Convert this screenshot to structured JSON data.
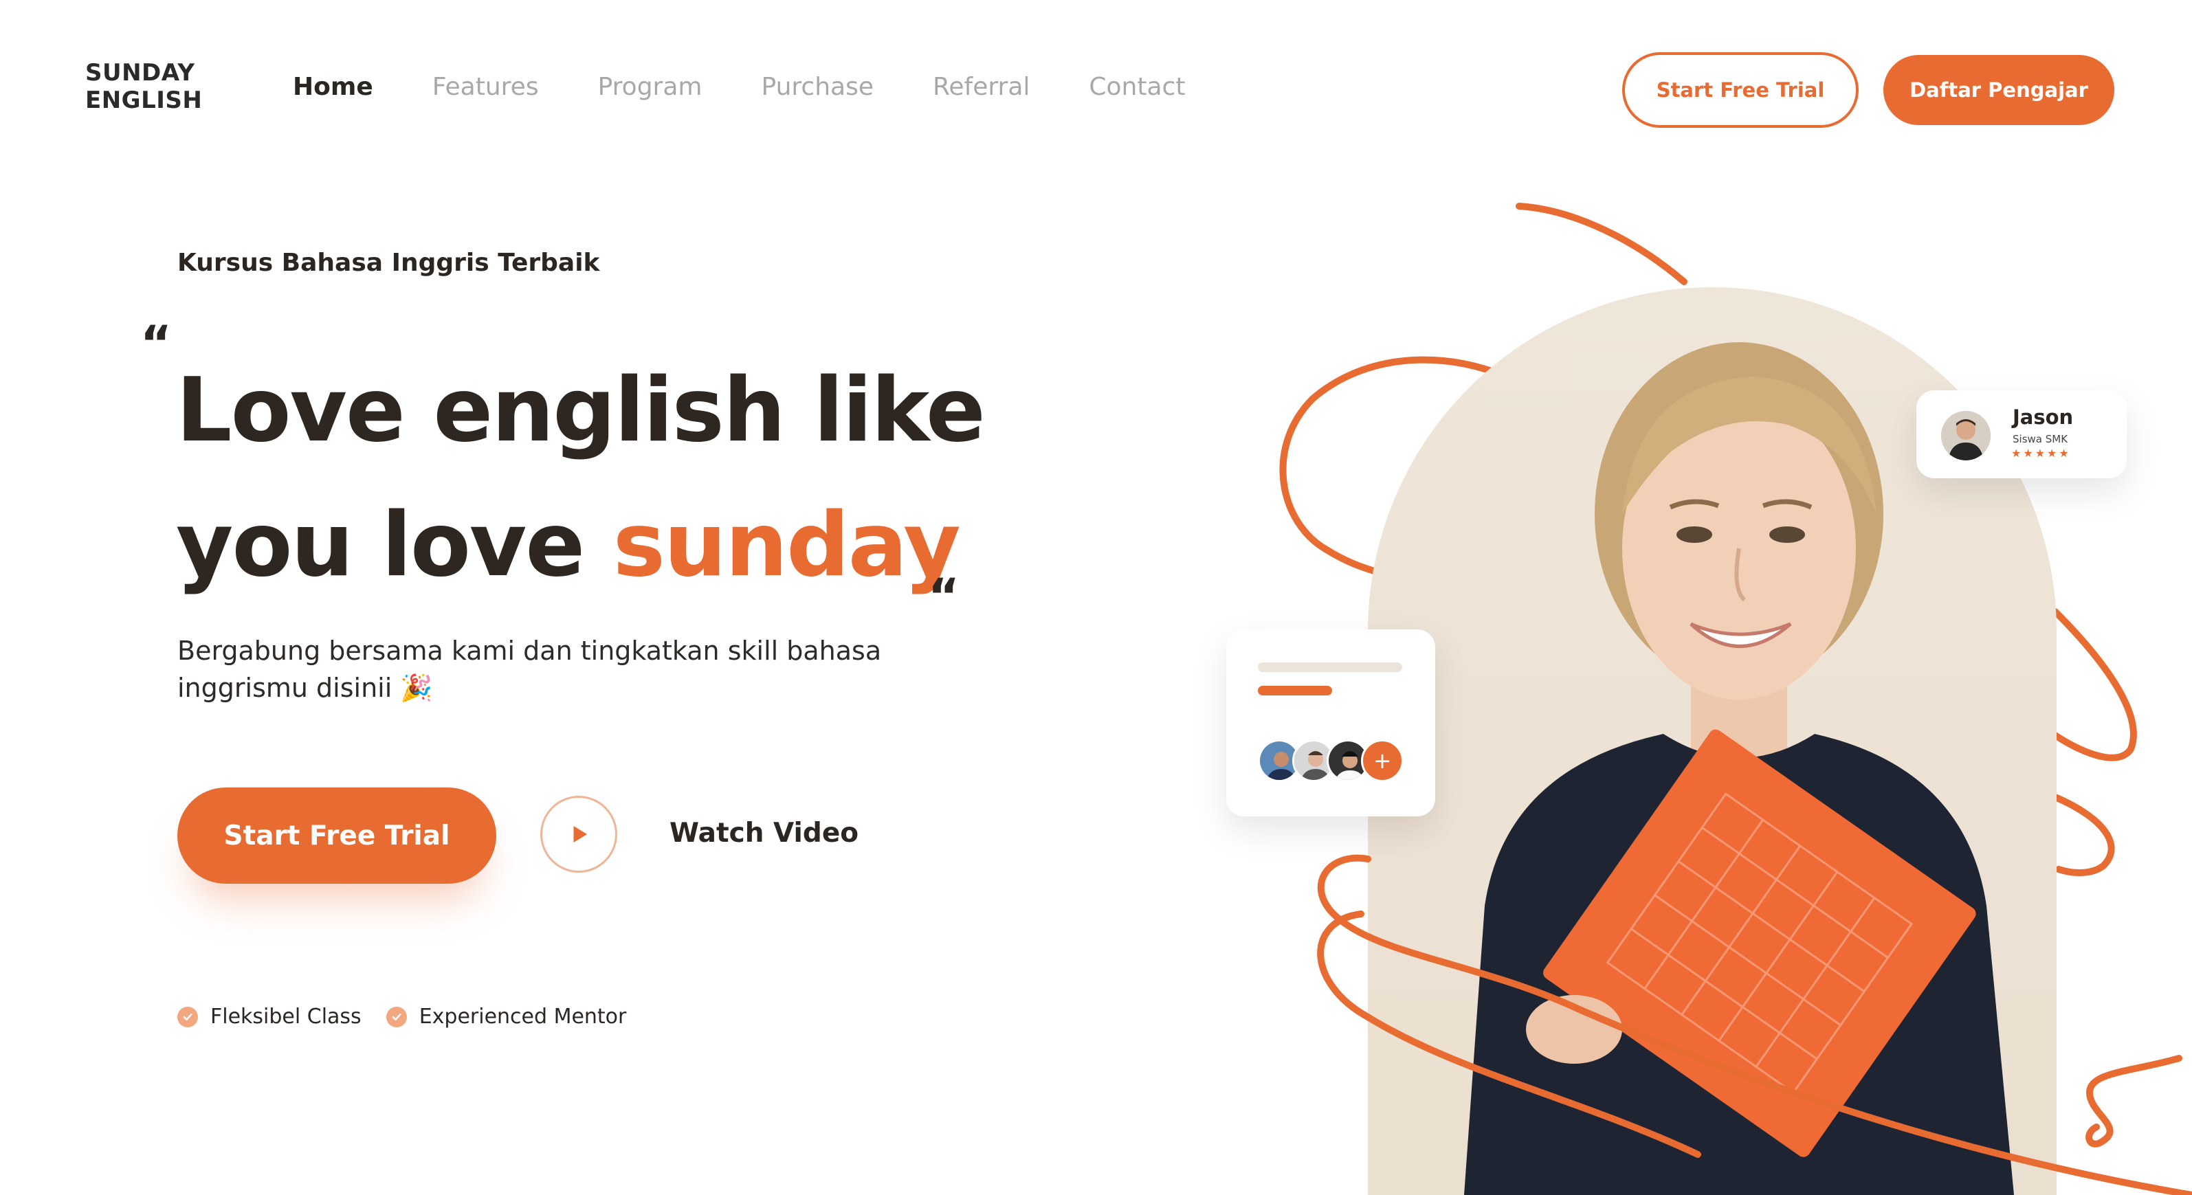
{
  "brand": {
    "line1": "SUNDAY",
    "line2": "ENGLISH"
  },
  "nav": {
    "items": [
      "Home",
      "Features",
      "Program",
      "Purchase",
      "Referral",
      "Contact"
    ],
    "active": "Home"
  },
  "header_actions": {
    "trial_label": "Start Free Trial",
    "teacher_label": "Daftar Pengajar"
  },
  "hero": {
    "eyebrow": "Kursus Bahasa Inggris Terbaik",
    "quote_open": "“",
    "quote_close": "“",
    "headline_line1": "Love english like",
    "headline_line2_prefix": "you love ",
    "headline_accent": "sunday",
    "subtext": "Bergabung bersama kami dan tingkatkan skill bahasa inggrismu disinii  🎉",
    "cta_label": "Start Free Trial",
    "watch_label": "Watch Video",
    "features": [
      "Fleksibel Class",
      "Experienced Mentor"
    ]
  },
  "testimonial_card": {
    "name": "Jason",
    "role": "Siswa SMK",
    "stars": "★★★★★",
    "rating": 5
  },
  "students_card": {
    "plus_label": "+"
  },
  "colors": {
    "accent": "#e86b32",
    "dark": "#2b2622",
    "muted": "#a8a8a8",
    "arch": "#efe6da"
  }
}
